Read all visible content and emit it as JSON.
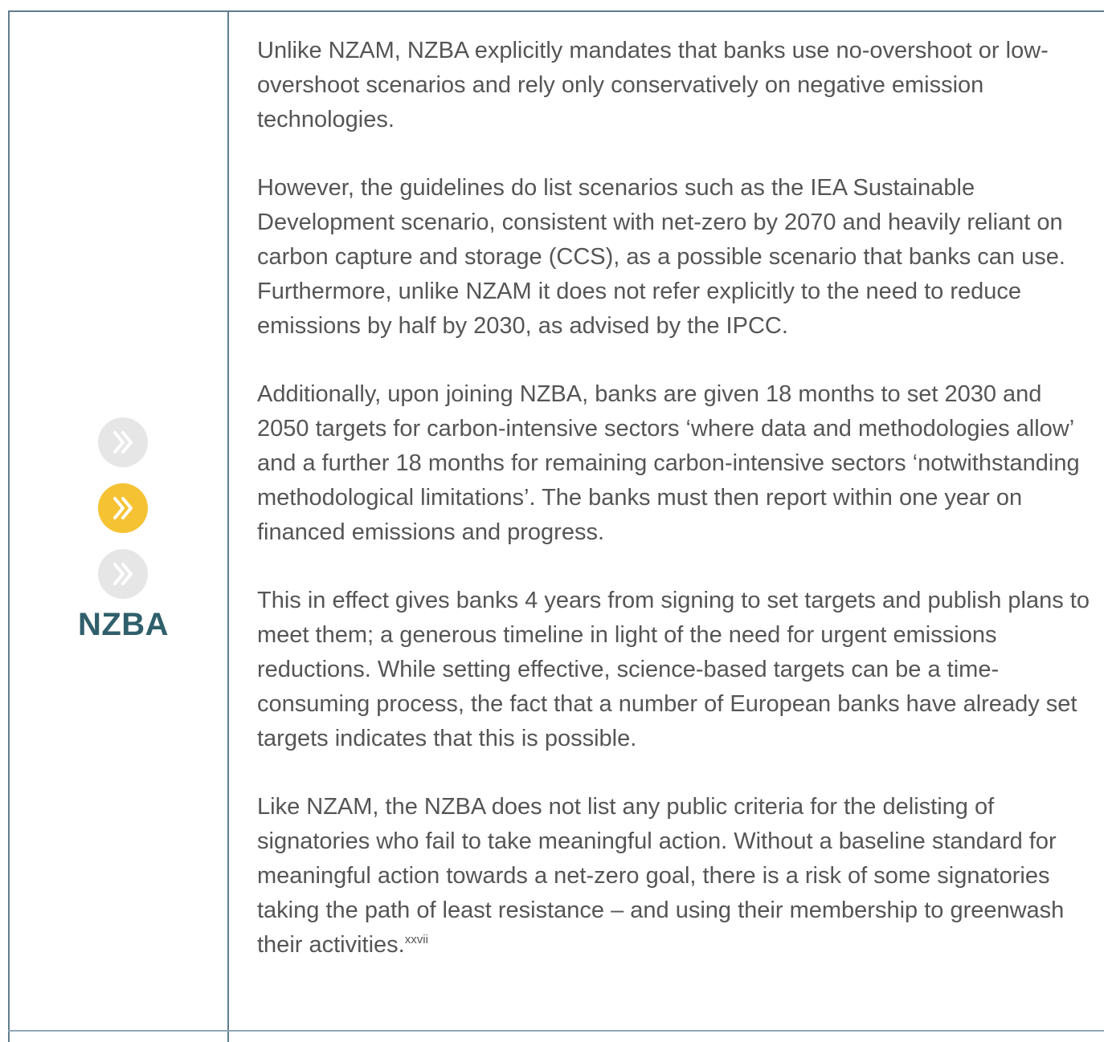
{
  "row": {
    "label": "NZBA",
    "chevron_icons": [
      {
        "icon": "double-chevron-right-icon",
        "color": "#e6e6e6",
        "active": false
      },
      {
        "icon": "double-chevron-right-icon",
        "color": "#f5c233",
        "active": true
      },
      {
        "icon": "double-chevron-right-icon",
        "color": "#e6e6e6",
        "active": false
      }
    ],
    "paragraphs": [
      "Unlike NZAM, NZBA explicitly mandates that banks use no-overshoot or low-overshoot scenarios and rely only conservatively on negative emission technologies.",
      "However, the guidelines do list scenarios such as the IEA Sustainable Development scenario, consistent with net-zero by 2070 and heavily reliant on carbon capture and storage (CCS), as a possible scenario that banks can use. Furthermore, unlike NZAM it does not refer explicitly to the need to reduce emissions by half by 2030, as advised by the IPCC.",
      "Additionally, upon joining NZBA, banks are given 18 months to set 2030 and 2050 targets for carbon-intensive sectors ‘where data and methodologies allow’ and a further 18 months for remaining carbon-intensive sectors ‘notwithstanding methodological limitations’. The banks must then report within one year on financed emissions and progress.",
      "This in effect gives banks 4 years from signing to set targets and publish plans to meet them; a generous timeline in light of the need for urgent emissions reductions. While setting effective, science-based targets can be a time-consuming process, the fact that a number of European banks have already set targets indicates that this is possible.",
      "Like NZAM, the NZBA does not list any public criteria for the delisting of signatories who fail to take meaningful action. Without a baseline standard for meaningful action towards a net-zero goal, there is a risk of some signatories taking the path of least resistance – and using their membership to greenwash their activities."
    ],
    "footnote_ref": "xxvii"
  },
  "colors": {
    "rule": "#5f7d8e",
    "label": "#2f5f6b",
    "text": "#555555",
    "accent": "#f5c233",
    "inactive": "#e6e6e6"
  }
}
